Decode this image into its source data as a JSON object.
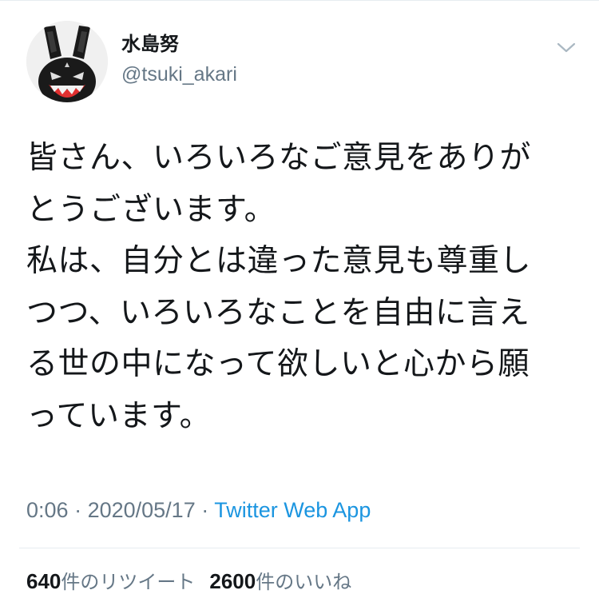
{
  "user": {
    "display_name": "水島努",
    "handle": "@tsuki_akari",
    "avatar_icon": "rabbit-mascot-avatar"
  },
  "menu_icon": "chevron-down-icon",
  "tweet": {
    "lines": [
      "皆さん、いろいろなご意見をありが",
      "とうございます。",
      "私は、自分とは違った意見も尊重し",
      "つつ、いろいろなことを自由に言え",
      "る世の中になって欲しいと心から願",
      "っています。"
    ]
  },
  "meta": {
    "time": "0:06",
    "date": "2020/05/17",
    "separator": "·",
    "source": "Twitter Web App"
  },
  "stats": {
    "retweets_count": "640",
    "retweets_label": "件のリツイート",
    "likes_count": "2600",
    "likes_label": "件のいいね"
  },
  "colors": {
    "text": "#14171a",
    "secondary": "#657786",
    "link": "#1b95e0",
    "divider": "#e6ecf0"
  }
}
